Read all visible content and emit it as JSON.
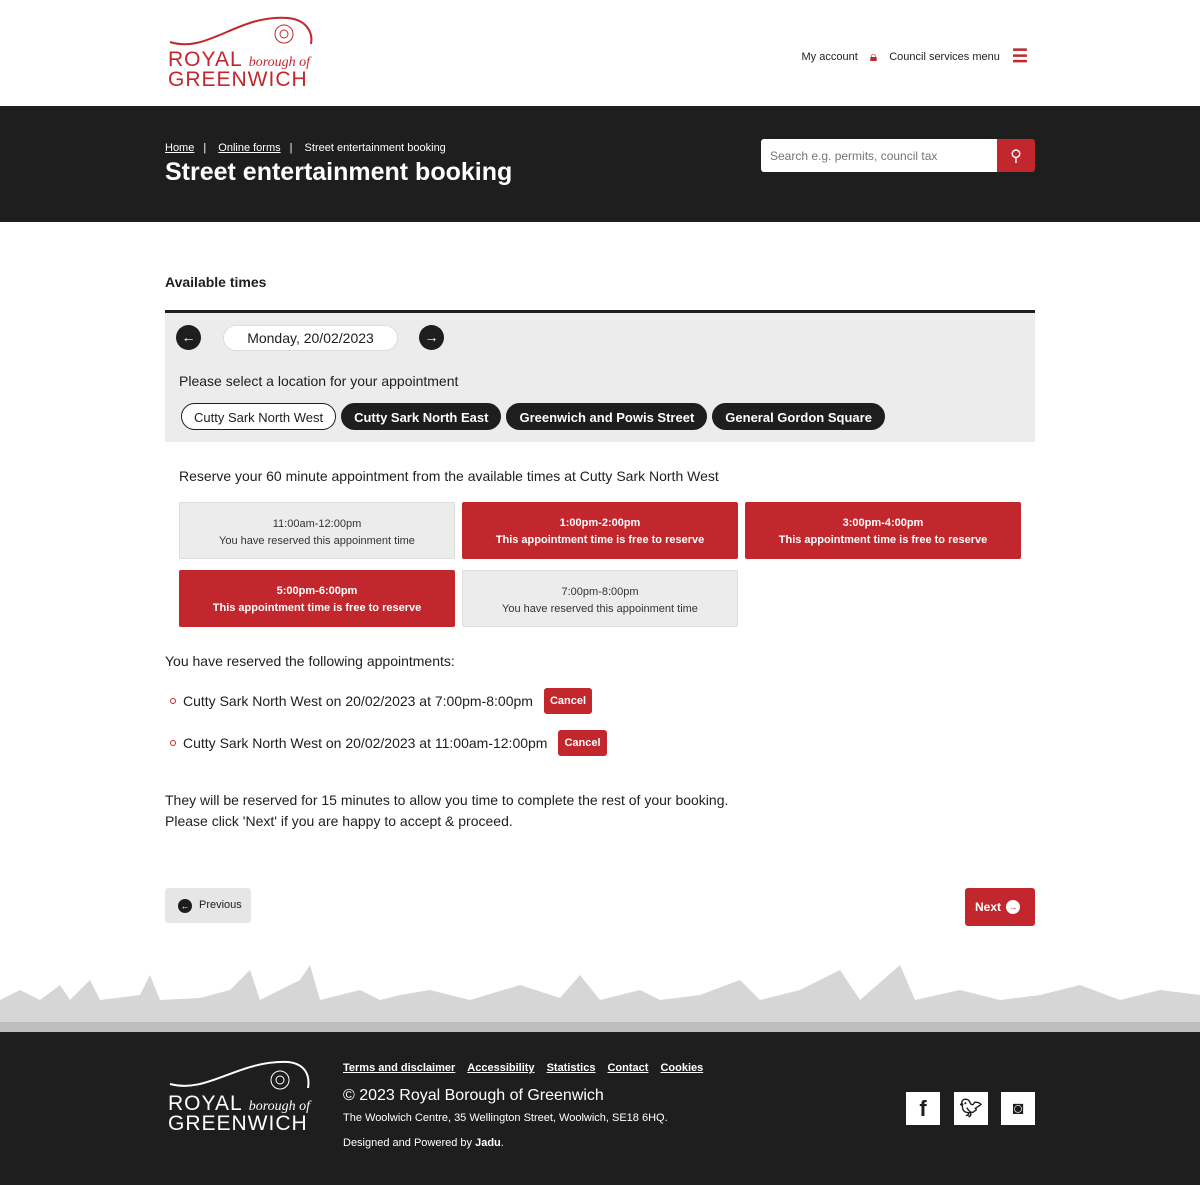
{
  "header": {
    "logo": {
      "line1": "ROYAL",
      "line1b": "borough of",
      "line2": "GREENWICH"
    },
    "my_account": "My account",
    "services_menu": "Council services menu"
  },
  "hero": {
    "breadcrumbs": [
      "Home",
      "Online forms",
      "Street entertainment booking"
    ],
    "title": "Street entertainment booking",
    "search_placeholder": "Search e.g. permits, council tax"
  },
  "main": {
    "available_label": "Available times",
    "date": "Monday, 20/02/2023",
    "location_prompt": "Please select a location for your appointment",
    "locations": [
      {
        "label": "Cutty Sark North West",
        "selected": true
      },
      {
        "label": "Cutty Sark North East"
      },
      {
        "label": "Greenwich and Powis Street"
      },
      {
        "label": "General Gordon Square"
      }
    ],
    "reserve_text": "Reserve your 60 minute appointment from the available times at Cutty Sark North West",
    "slots": [
      {
        "time": "11:00am-12:00pm",
        "status": "You have reserved this appoinment time",
        "state": "reserved"
      },
      {
        "time": "1:00pm-2:00pm",
        "status": "This appointment time is free to reserve",
        "state": "free"
      },
      {
        "time": "3:00pm-4:00pm",
        "status": "This appointment time is free to reserve",
        "state": "free"
      },
      {
        "time": "5:00pm-6:00pm",
        "status": "This appointment time is free to reserve",
        "state": "free"
      },
      {
        "time": "7:00pm-8:00pm",
        "status": "You have reserved this appoinment time",
        "state": "reserved"
      }
    ],
    "reserved_label": "You have reserved the following appointments:",
    "reserved": [
      {
        "text": "Cutty Sark North West on 20/02/2023 at 7:00pm-8:00pm",
        "cancel": "Cancel"
      },
      {
        "text": "Cutty Sark North West on 20/02/2023 at 11:00am-12:00pm",
        "cancel": "Cancel"
      }
    ],
    "note1": "They will be reserved for 15 minutes to allow you time to complete the rest of your booking.",
    "note2": "Please click 'Next' if you are happy to accept & proceed.",
    "previous": "Previous",
    "next": "Next"
  },
  "footer": {
    "links": [
      "Terms and disclaimer",
      "Accessibility",
      "Statistics",
      "Contact",
      "Cookies"
    ],
    "copyright": "© 2023 Royal Borough of Greenwich",
    "address": "The Woolwich Centre, 35 Wellington Street, Woolwich, SE18 6HQ.",
    "designed": "Designed and Powered by",
    "jadu": "Jadu",
    "social": [
      "facebook",
      "twitter",
      "instagram"
    ]
  },
  "colors": {
    "brand_red": "#c1272d",
    "dark": "#1e1e1e"
  }
}
